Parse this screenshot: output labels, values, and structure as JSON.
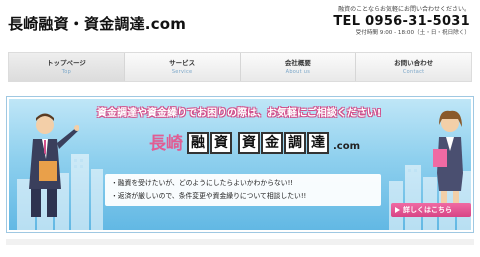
{
  "header": {
    "site_title": "長崎融資・資金調達.com",
    "contact_note": "融資のことならお気軽にお問い合わせください。",
    "tel": "TEL 0956-31-5031",
    "hours": "受付時間 9:00 - 18:00（土・日・祝日除く）"
  },
  "nav": {
    "items": [
      {
        "label": "トップページ",
        "sub": "Top"
      },
      {
        "label": "サービス",
        "sub": "Service"
      },
      {
        "label": "会社概要",
        "sub": "About us"
      },
      {
        "label": "お問い合わせ",
        "sub": "Contact"
      }
    ]
  },
  "banner": {
    "headline": "資金調達や資金繰りでお困りの際は、お気軽にご相談ください!",
    "logo": {
      "prefix": "長崎",
      "boxes1": [
        "融",
        "資"
      ],
      "boxes2": [
        "資",
        "金",
        "調",
        "達"
      ],
      "suffix": ".com"
    },
    "bullets": [
      "・融資を受けたいが、どのようにしたらよいかわからない!!",
      "・返済が厳しいので、条件変更や資金繰りについて相談したい!!"
    ],
    "cta_label": "詳しくはこちら"
  },
  "colors": {
    "accent_pink": "#e05d93",
    "banner_blue": "#8fd0ee",
    "nav_sub_text": "#7aa6c8"
  }
}
